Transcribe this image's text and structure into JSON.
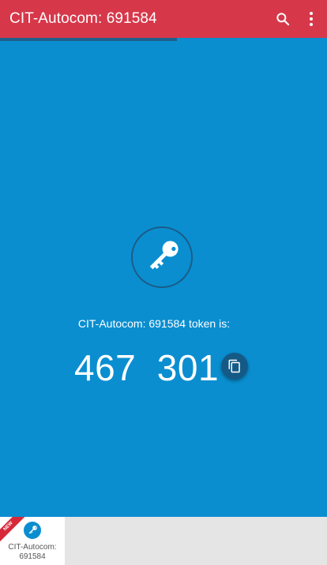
{
  "colors": {
    "topbar": "#d6384a",
    "main": "#0a8ed0",
    "copy_button": "#155a86",
    "progress": "#1f5f8b"
  },
  "app_bar": {
    "title": "CIT-Autocom: 691584",
    "search_icon": "search-icon",
    "menu_icon": "more-vert-icon"
  },
  "timer": {
    "progress_fraction": 0.54
  },
  "token_view": {
    "icon": "key-icon",
    "label": "CIT-Autocom: 691584 token is:",
    "token": "467  301",
    "copy_icon": "copy-icon"
  },
  "accounts": [
    {
      "line1": "CIT-Autocom:",
      "line2": "691584",
      "badge": "NEW",
      "icon": "key-icon"
    }
  ]
}
